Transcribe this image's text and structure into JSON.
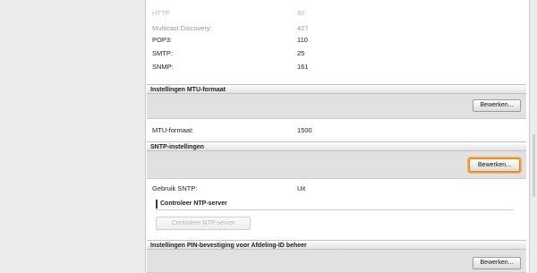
{
  "ports": [
    {
      "label": "HTTP",
      "value": "80",
      "faded": true
    },
    {
      "label": "Multicast Discovery:",
      "value": "427",
      "muted": true
    },
    {
      "label": "POP3:",
      "value": "110"
    },
    {
      "label": "SMTP:",
      "value": "25"
    },
    {
      "label": "SNMP:",
      "value": "161"
    }
  ],
  "mtu": {
    "header": "Instellingen MTU-formaat",
    "edit_label": "Bewerken...",
    "field_label": "MTU-formaat:",
    "field_value": "1500"
  },
  "sntp": {
    "header": "SNTP-instellingen",
    "edit_label": "Bewerken...",
    "field_label": "Gebruik SNTP:",
    "field_value": "Uit",
    "check_header": "Controleer NTP-server",
    "check_button": "Controleer NTP-server"
  },
  "pin": {
    "header": "Instellingen PIN-bevestiging voor Afdeling-ID beheer",
    "edit_label": "Bewerken..."
  },
  "colors": {
    "highlight": "#f29a3a"
  }
}
